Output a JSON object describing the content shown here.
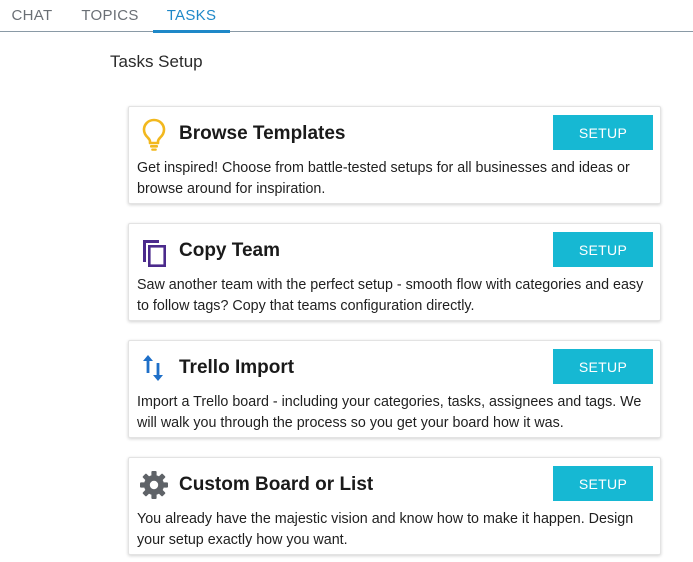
{
  "tabs": [
    {
      "label": "CHAT",
      "active": false
    },
    {
      "label": "TOPICS",
      "active": false
    },
    {
      "label": "TASKS",
      "active": true
    }
  ],
  "page_title": "Tasks Setup",
  "colors": {
    "accent": "#1e88c8",
    "button": "#16b8d3",
    "lightbulb": "#f2b81e",
    "copy": "#4b2a8c",
    "arrows": "#1e6fc8",
    "gear": "#5f6368"
  },
  "cards": [
    {
      "icon": "lightbulb-icon",
      "title": "Browse Templates",
      "button": "SETUP",
      "description": "Get inspired! Choose from battle-tested setups for all businesses and ideas or browse around for inspiration."
    },
    {
      "icon": "copy-icon",
      "title": "Copy Team",
      "button": "SETUP",
      "description": "Saw another team with the perfect setup - smooth flow with categories and easy to follow tags? Copy that teams configuration directly."
    },
    {
      "icon": "swap-arrows-icon",
      "title": "Trello Import",
      "button": "SETUP",
      "description": "Import a Trello board - including your categories, tasks, assignees and tags. We will walk you through the process so you get your board how it was."
    },
    {
      "icon": "gear-icon",
      "title": "Custom Board or List",
      "button": "SETUP",
      "description": "You already have the majestic vision and know how to make it happen. Design your setup exactly how you want."
    }
  ]
}
